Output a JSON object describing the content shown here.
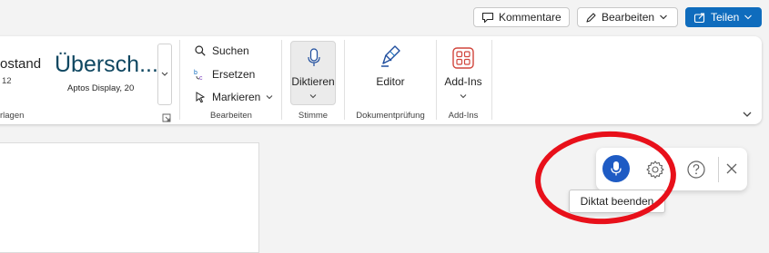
{
  "top_actions": {
    "comments_label": "Kommentare",
    "edit_label": "Bearbeiten",
    "share_label": "Teilen"
  },
  "styles": {
    "normal_label": "ostand",
    "normal_size": "12",
    "heading_label": "Übersch...",
    "heading_font": "Aptos Display, 20",
    "group_label": "rlagen"
  },
  "edit_group": {
    "search_label": "Suchen",
    "replace_label": "Ersetzen",
    "select_label": "Markieren",
    "group_label": "Bearbeiten"
  },
  "voice_group": {
    "dictate_label": "Diktieren",
    "group_label": "Stimme"
  },
  "proofing_group": {
    "editor_label": "Editor",
    "group_label": "Dokumentprüfung"
  },
  "addins_group": {
    "addins_label": "Add-Ins",
    "group_label": "Add-Ins"
  },
  "dictation_toolbar": {
    "tooltip": "Diktat beenden"
  },
  "colors": {
    "accent": "#0f6cbd",
    "mic_active": "#1e5bc4",
    "annotation_red": "#e8101a"
  }
}
